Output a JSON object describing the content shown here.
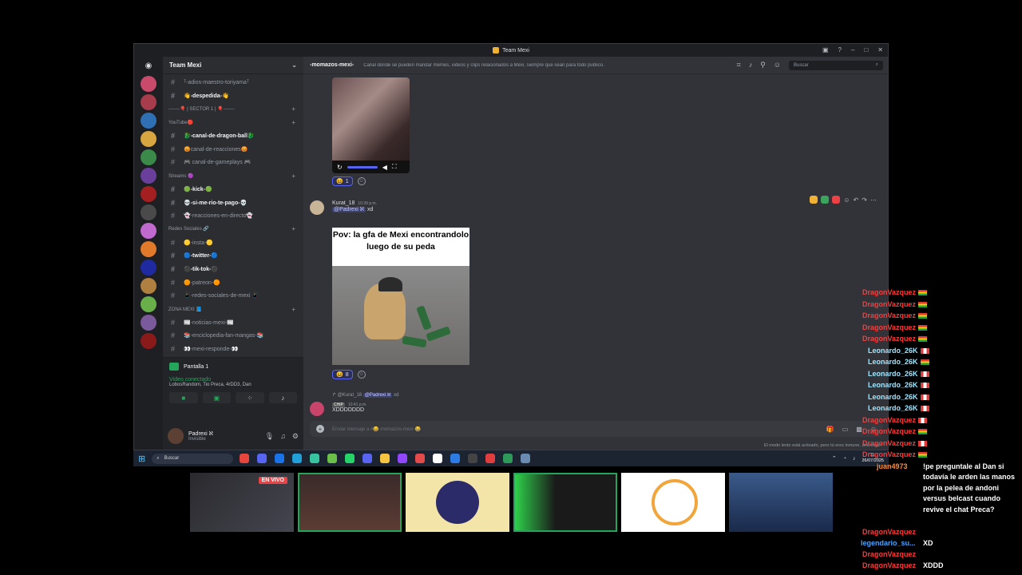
{
  "window": {
    "title": "Team Mexi"
  },
  "guild": {
    "name": "Team Mexi"
  },
  "channels": [
    {
      "kind": "channel",
      "label": "ᵀ-adios-maestro-toriyamaᵀ",
      "unread": false
    },
    {
      "kind": "channel",
      "label": "👋-despedida-👋",
      "unread": true
    },
    {
      "kind": "category",
      "label": "-------🎈 | SECTOR 1 | 🎈-------"
    },
    {
      "kind": "category",
      "label": "YouTube🔴"
    },
    {
      "kind": "channel",
      "label": "🐉-canal-de-dragon-ball🐉",
      "unread": true
    },
    {
      "kind": "channel",
      "label": "😡canal-de-reacciones😡",
      "unread": false
    },
    {
      "kind": "channel",
      "label": "🎮 canal-de-gameplays 🎮",
      "unread": false
    },
    {
      "kind": "category",
      "label": "Streams 🟣"
    },
    {
      "kind": "channel",
      "label": "🟢-kick-🟢",
      "unread": true
    },
    {
      "kind": "channel",
      "label": "💀-si-me-rio-te-pago-💀",
      "unread": true
    },
    {
      "kind": "channel",
      "label": "👻-reacciones-en-directo👻",
      "unread": false
    },
    {
      "kind": "category",
      "label": "Redes Sociales 🔗"
    },
    {
      "kind": "channel",
      "label": "🟡-insta-🟡",
      "unread": false
    },
    {
      "kind": "channel",
      "label": "🔵-twitter-🔵",
      "unread": true
    },
    {
      "kind": "channel",
      "label": "⚫-tik-tok-⚫",
      "unread": true
    },
    {
      "kind": "channel",
      "label": "🟠-patreon-🟠",
      "unread": false
    },
    {
      "kind": "channel",
      "label": "📱-redes-sociales-de-mexi 📱",
      "unread": false
    },
    {
      "kind": "category",
      "label": "ZONA MEXI 📘"
    },
    {
      "kind": "channel",
      "label": "📰-noticias-mexi-📰",
      "unread": false
    },
    {
      "kind": "channel",
      "label": "📚-enciclopedia-fan-mangas-📚",
      "unread": false
    },
    {
      "kind": "channel",
      "label": "👀-mexi-responde-👀",
      "unread": false
    }
  ],
  "voice": {
    "screen_label": "Pantalla 1",
    "status": "Video conectado",
    "members": "LobosRandom, Tio Preca, 4rDD3, Dan"
  },
  "user": {
    "name": "Padrexi ℵ",
    "status": "Invisible"
  },
  "header": {
    "channel": "-momazos-mexi-",
    "topic": "Canal donde se pueden mandar memes, videos y clips relacionados a Mexi, siempre que sean para todo publico.",
    "search_placeholder": "Buscar"
  },
  "messages": {
    "video_reaction_count": "1",
    "post": {
      "author": "Kurat_18",
      "time": "10:39 p.m.",
      "mention": "@Padrexi ℵ",
      "text": "xd",
      "meme_caption": "Pov: la gfa de Mexi encontrandolo luego de su peda",
      "reaction_count": "8"
    },
    "reply": {
      "reply_author": "@Kurat_18",
      "reply_mention": "@Padrexi ℵ",
      "reply_text": "xd",
      "badge": "CHIP",
      "time": "10:41 p.m.",
      "text": "XDDDDDDD",
      "reaction_count": "1"
    }
  },
  "composer": {
    "placeholder": "Enviar mensaje a #😂-momazos-mexi-😂",
    "slowmode": "El modo lento está activado, pero tú eres inmune. ¡Increíble!"
  },
  "taskbar": {
    "search": "Buscar",
    "time": "11:",
    "date": "26/07/2025"
  },
  "stream": {
    "live_badge": "EN VIVO"
  },
  "chat": [
    {
      "user": "DragonVazquez",
      "color": "red",
      "flag": "bo"
    },
    {
      "user": "DragonVazquez",
      "color": "red",
      "flag": "bo"
    },
    {
      "user": "DragonVazquez",
      "color": "red",
      "flag": "bo"
    },
    {
      "user": "DragonVazquez",
      "color": "red",
      "flag": "bo"
    },
    {
      "user": "DragonVazquez",
      "color": "red",
      "flag": "bo"
    },
    {
      "user": "Leonardo_26K",
      "color": "cyan",
      "flag": "pe"
    },
    {
      "user": "Leonardo_26K",
      "color": "cyan",
      "flag": "bo"
    },
    {
      "user": "Leonardo_26K",
      "color": "cyan",
      "flag": "pe"
    },
    {
      "user": "Leonardo_26K",
      "color": "cyan",
      "flag": "pe"
    },
    {
      "user": "Leonardo_26K",
      "color": "cyan",
      "flag": "pe"
    },
    {
      "user": "Leonardo_26K",
      "color": "cyan",
      "flag": "pe"
    },
    {
      "user": "DragonVazquez",
      "color": "red",
      "flag": "pe"
    },
    {
      "user": "DragonVazquez",
      "color": "red",
      "flag": "bo"
    },
    {
      "user": "DragonVazquez",
      "color": "red",
      "flag": "pe"
    },
    {
      "user": "DragonVazquez",
      "color": "red",
      "flag": "bo"
    }
  ],
  "chat_tail": {
    "juan_name": "juan4973",
    "juan_msg": "!pe preguntale al Dan si todavía le arden las manos por la pelea de andoni versus belcast cuando revive el chat Preca?",
    "d1": "DragonVazquez",
    "legend": "legendario_su...",
    "legend_msg": "XD",
    "d2": "DragonVazquez",
    "d3": "DragonVazquez",
    "d3_msg": "XDDD"
  },
  "colors": {
    "discord_bg": "#313338",
    "sidebar_bg": "#2b2d31",
    "accent": "#5865f2",
    "voice_green": "#23a55a",
    "chat_red": "#ff3a3a",
    "chat_cyan": "#9fe6ff"
  }
}
